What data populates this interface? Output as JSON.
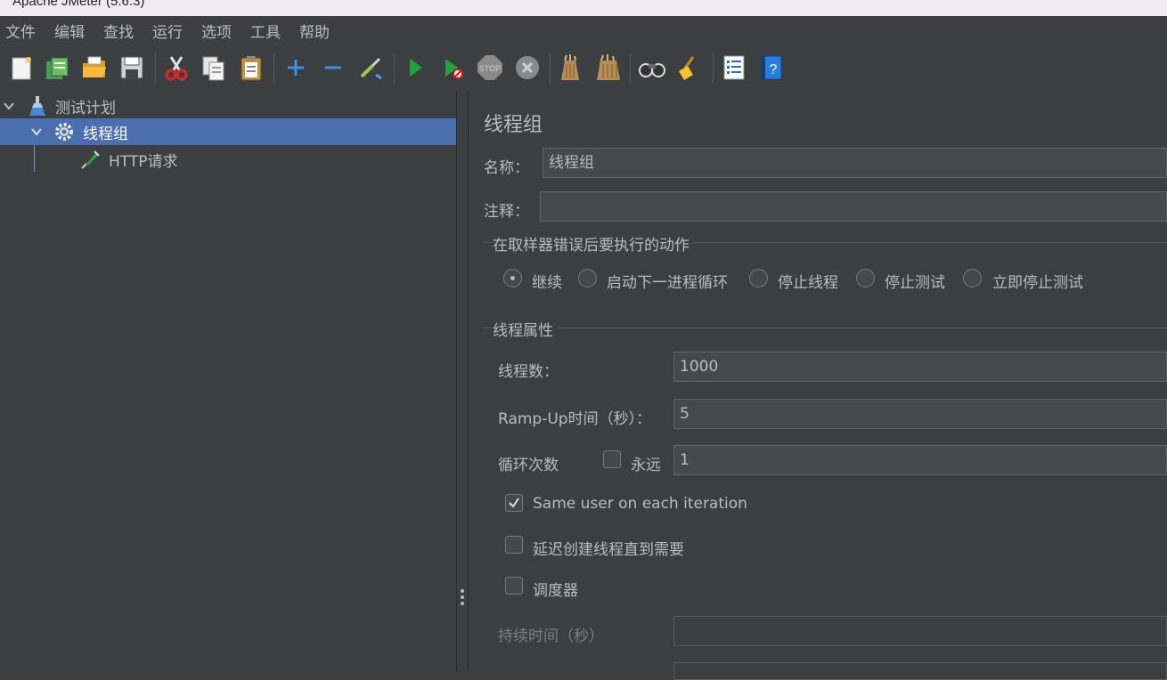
{
  "window": {
    "title": "Apache JMeter (5.6.3)"
  },
  "menu": {
    "items": [
      "文件",
      "编辑",
      "查找",
      "运行",
      "选项",
      "工具",
      "帮助"
    ]
  },
  "toolbar": {
    "buttons": [
      "new-icon",
      "templates-icon",
      "open-icon",
      "save-icon",
      "cut-icon",
      "copy-icon",
      "paste-icon",
      "expand-icon",
      "collapse-icon",
      "toggle-icon",
      "start-icon",
      "start-no-pause-icon",
      "stop-icon",
      "shutdown-icon",
      "clear-icon",
      "clear-all-icon",
      "search-icon",
      "reset-search-icon",
      "function-helper-icon",
      "help-icon"
    ]
  },
  "tree": {
    "nodes": [
      {
        "label": "测试计划",
        "icon": "test-plan-icon",
        "expanded": true
      },
      {
        "label": "线程组",
        "icon": "thread-group-icon",
        "expanded": true,
        "selected": true
      },
      {
        "label": "HTTP请求",
        "icon": "http-sampler-icon"
      }
    ]
  },
  "panel": {
    "title": "线程组",
    "name_label": "名称：",
    "name_value": "线程组",
    "comment_label": "注释：",
    "comment_value": "",
    "error_action": {
      "title": "在取样器错误后要执行的动作",
      "options": [
        "继续",
        "启动下一进程循环",
        "停止线程",
        "停止测试",
        "立即停止测试"
      ],
      "selected": "继续"
    },
    "thread_props": {
      "title": "线程属性",
      "threads_label": "线程数：",
      "threads_value": "1000",
      "rampup_label": "Ramp-Up时间（秒）：",
      "rampup_value": "5",
      "loop_label": "循环次数",
      "forever_label": "永远",
      "forever_checked": false,
      "loop_value": "1",
      "same_user_label": "Same user on each iteration",
      "same_user_checked": true,
      "delay_label": "延迟创建线程直到需要",
      "delay_checked": false,
      "scheduler_label": "调度器",
      "scheduler_checked": false,
      "duration_label": "持续时间（秒）",
      "duration_value": ""
    }
  },
  "colors": {
    "background": "#3c3f41",
    "selection": "#4b6eaf",
    "text": "#bbbbbb",
    "field": "#45494a"
  }
}
